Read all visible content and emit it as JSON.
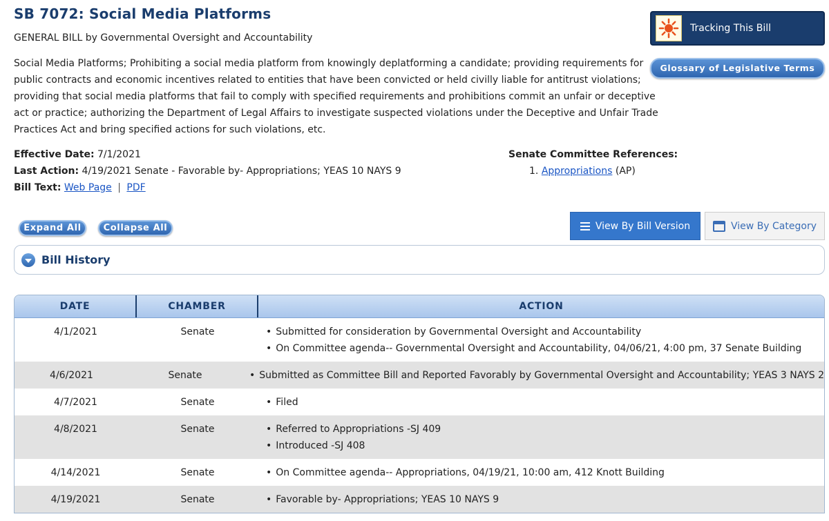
{
  "bill": {
    "title": "SB 7072: Social Media Platforms",
    "subtitle": "GENERAL BILL by Governmental Oversight and Accountability",
    "description": "Social Media Platforms; Prohibiting a social media platform from knowingly deplatforming a candidate; providing requirements for public contracts and economic incentives related to entities that have been convicted or held civilly liable for antitrust violations; providing that social media platforms that fail to comply with specified requirements and prohibitions commit an unfair or deceptive act or practice; authorizing the Department of Legal Affairs to investigate suspected violations under the Deceptive and Unfair Trade Practices Act and bring specified actions for such violations, etc."
  },
  "buttons": {
    "tracking": "Tracking This Bill",
    "glossary": "Glossary of Legislative Terms",
    "expand_all": "Expand All",
    "collapse_all": "Collapse All",
    "view_by_version": "View By Bill Version",
    "view_by_category": "View By Category"
  },
  "meta": {
    "effective_date_label": "Effective Date:",
    "effective_date": "7/1/2021",
    "last_action_label": "Last Action:",
    "last_action": "4/19/2021 Senate - Favorable by- Appropriations; YEAS 10 NAYS 9",
    "bill_text_label": "Bill Text:",
    "web_page_link": "Web Page",
    "separator": "|",
    "pdf_link": "PDF"
  },
  "committee": {
    "heading": "Senate Committee References:",
    "item_number": "1.",
    "item_link": "Appropriations",
    "item_abbr": "(AP)"
  },
  "history": {
    "label": "Bill History",
    "columns": [
      "DATE",
      "CHAMBER",
      "ACTION"
    ],
    "rows": [
      {
        "date": "4/1/2021",
        "chamber": "Senate",
        "actions": [
          "Submitted for consideration by Governmental Oversight and Accountability",
          "On Committee agenda-- Governmental Oversight and Accountability, 04/06/21, 4:00 pm, 37 Senate Building"
        ]
      },
      {
        "date": "4/6/2021",
        "chamber": "Senate",
        "actions": [
          "Submitted as Committee Bill and Reported Favorably by Governmental Oversight and Accountability; YEAS 3 NAYS 2"
        ]
      },
      {
        "date": "4/7/2021",
        "chamber": "Senate",
        "actions": [
          "Filed"
        ]
      },
      {
        "date": "4/8/2021",
        "chamber": "Senate",
        "actions": [
          "Referred to Appropriations -SJ 409",
          "Introduced -SJ 408"
        ]
      },
      {
        "date": "4/14/2021",
        "chamber": "Senate",
        "actions": [
          "On Committee agenda-- Appropriations, 04/19/21, 10:00 am, 412 Knott Building"
        ]
      },
      {
        "date": "4/19/2021",
        "chamber": "Senate",
        "actions": [
          "Favorable by- Appropriations; YEAS 10 NAYS 9"
        ]
      }
    ]
  },
  "colors": {
    "title": "#1a3d6d",
    "link": "#1a55c4",
    "accent_button": "#3577cc",
    "alt_row": "#e2e2e2"
  },
  "icons": {
    "tracking": "sun-icon",
    "toggle": "chevron-down-icon",
    "version": "list-icon",
    "category": "calendar-icon"
  }
}
